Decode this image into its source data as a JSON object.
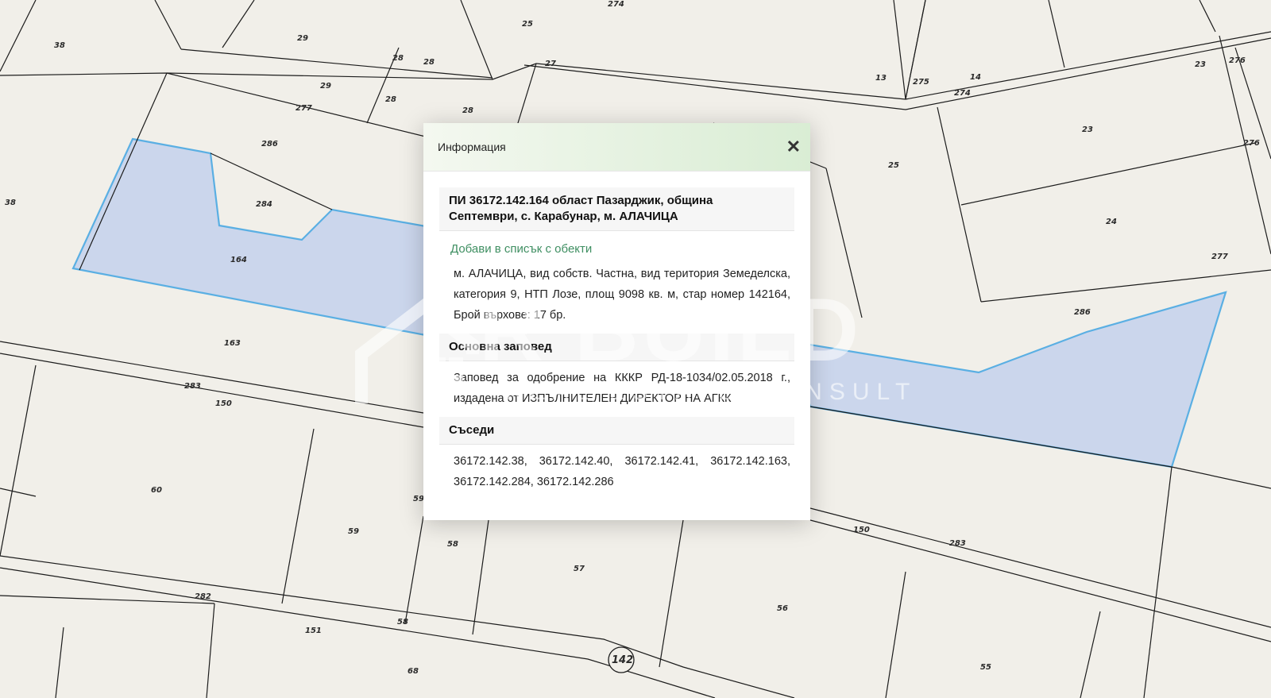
{
  "map": {
    "parcel_labels": [
      "38",
      "29",
      "25",
      "274",
      "28",
      "28",
      "29",
      "28",
      "27",
      "277",
      "28",
      "286",
      "38",
      "284",
      "164",
      "163",
      "283",
      "150",
      "13",
      "275",
      "14",
      "274",
      "23",
      "276",
      "25",
      "23",
      "276",
      "24",
      "277",
      "286",
      "60",
      "59",
      "59",
      "58",
      "57",
      "56",
      "150",
      "283",
      "282",
      "151",
      "58",
      "68",
      "55"
    ],
    "circle_label": "142",
    "selected_parcel_color": "#c7d3ec",
    "selected_outline_color": "#5aafe3"
  },
  "popup": {
    "title": "Информация",
    "close_icon": "close-icon",
    "header": "ПИ 36172.142.164 област Пазарджик, община Септември, с. Карабунар, м. АЛАЧИЦА",
    "add_link": "Добави в списък с обекти",
    "description": "м. АЛАЧИЦА, вид собств. Частна, вид територия Земеделска, категория 9, НТП Лозе, площ 9098 кв. м, стар номер 142164, Брой върхове: 17 бр.",
    "order_title": "Основна заповед",
    "order_text": "Заповед за одобрение на КККР РД-18-1034/02.05.2018 г., издадена от ИЗПЪЛНИТЕЛЕН ДИРЕКТОР НА АГКК",
    "neighbors_title": "Съседи",
    "neighbors_text": "36172.142.38, 36172.142.40, 36172.142.41, 36172.142.163, 36172.142.284, 36172.142.286"
  },
  "watermark": {
    "main": "R BUILD",
    "sub": "REAL ESTATE CONSULT"
  },
  "colors": {
    "accent_green": "#3f8f62",
    "map_background": "#f1efe9"
  }
}
